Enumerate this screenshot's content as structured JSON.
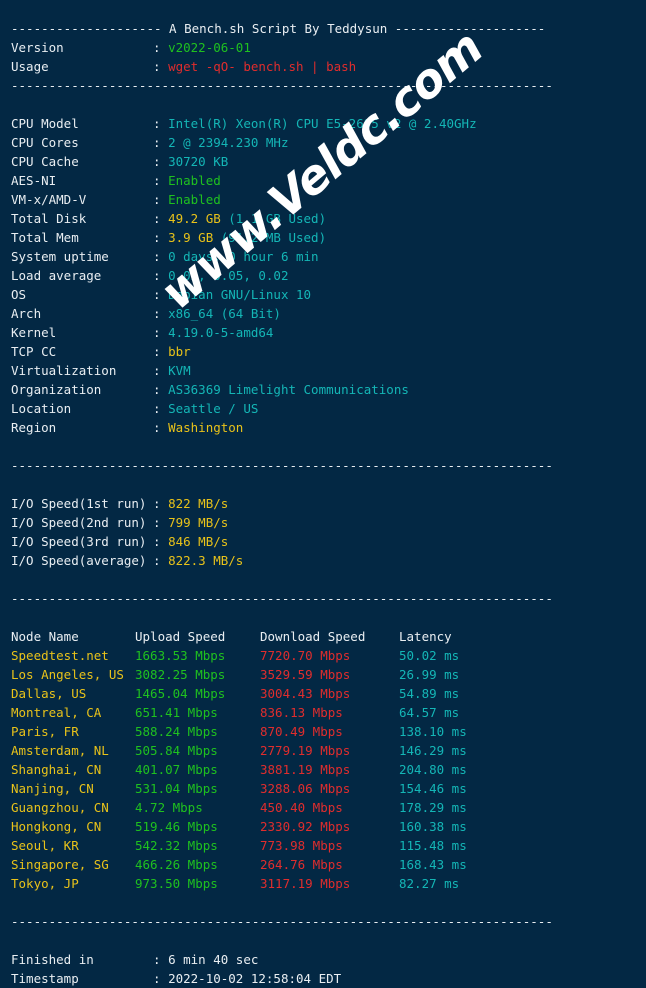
{
  "terminal": {
    "background": "#032844",
    "separator": "------------------------------------------------------------------------",
    "header_line": "-------------------- A Bench.sh Script By Teddysun --------------------"
  },
  "watermark": {
    "text": "www.Veldc.com"
  },
  "intro": {
    "rows": [
      {
        "label": "Version",
        "value": "v2022-06-01",
        "color": "green"
      },
      {
        "label": "Usage",
        "value": "wget -qO- bench.sh | bash",
        "color": "red"
      }
    ]
  },
  "sysinfo": {
    "rows": [
      {
        "label": "CPU Model",
        "value": "Intel(R) Xeon(R) CPU E5-2695 v2 @ 2.40GHz",
        "color": "cyan"
      },
      {
        "label": "CPU Cores",
        "value": "2 @ 2394.230 MHz",
        "color": "cyan"
      },
      {
        "label": "CPU Cache",
        "value": "30720 KB",
        "color": "cyan"
      },
      {
        "label": "AES-NI",
        "value": "Enabled",
        "color": "green"
      },
      {
        "label": "VM-x/AMD-V",
        "value": "Enabled",
        "color": "green"
      },
      {
        "label": "Total Disk",
        "value": "49.2 GB",
        "suffix": " (1.1 GB Used)",
        "color": "yellow",
        "suffix_color": "cyan"
      },
      {
        "label": "Total Mem",
        "value": "3.9 GB",
        "suffix": " (91.2 MB Used)",
        "color": "yellow",
        "suffix_color": "cyan"
      },
      {
        "label": "System uptime",
        "value": "0 days, 0 hour 6 min",
        "color": "cyan"
      },
      {
        "label": "Load average",
        "value": "0.02, 0.05, 0.02",
        "color": "cyan"
      },
      {
        "label": "OS",
        "value": "Debian GNU/Linux 10",
        "color": "cyan"
      },
      {
        "label": "Arch",
        "value": "x86_64 (64 Bit)",
        "color": "cyan"
      },
      {
        "label": "Kernel",
        "value": "4.19.0-5-amd64",
        "color": "cyan"
      },
      {
        "label": "TCP CC",
        "value": "bbr",
        "color": "yellow"
      },
      {
        "label": "Virtualization",
        "value": "KVM",
        "color": "cyan"
      },
      {
        "label": "Organization",
        "value": "AS36369 Limelight Communications",
        "color": "cyan"
      },
      {
        "label": "Location",
        "value": "Seattle / US",
        "color": "cyan"
      },
      {
        "label": "Region",
        "value": "Washington",
        "color": "yellow"
      }
    ]
  },
  "io": {
    "rows": [
      {
        "label": "I/O Speed(1st run)",
        "value": "822 MB/s",
        "color": "yellow"
      },
      {
        "label": "I/O Speed(2nd run)",
        "value": "799 MB/s",
        "color": "yellow"
      },
      {
        "label": "I/O Speed(3rd run)",
        "value": "846 MB/s",
        "color": "yellow"
      },
      {
        "label": "I/O Speed(average)",
        "value": "822.3 MB/s",
        "color": "yellow"
      }
    ]
  },
  "speedtest": {
    "columns": [
      "Node Name",
      "Upload Speed",
      "Download Speed",
      "Latency"
    ],
    "rows": [
      {
        "node": "Speedtest.net",
        "upload": "1663.53 Mbps",
        "download": "7720.70 Mbps",
        "latency": "50.02 ms"
      },
      {
        "node": "Los Angeles, US",
        "upload": "3082.25 Mbps",
        "download": "3529.59 Mbps",
        "latency": "26.99 ms"
      },
      {
        "node": "Dallas, US",
        "upload": "1465.04 Mbps",
        "download": "3004.43 Mbps",
        "latency": "54.89 ms"
      },
      {
        "node": "Montreal, CA",
        "upload": "651.41 Mbps",
        "download": "836.13 Mbps",
        "latency": "64.57 ms"
      },
      {
        "node": "Paris, FR",
        "upload": "588.24 Mbps",
        "download": "870.49 Mbps",
        "latency": "138.10 ms"
      },
      {
        "node": "Amsterdam, NL",
        "upload": "505.84 Mbps",
        "download": "2779.19 Mbps",
        "latency": "146.29 ms"
      },
      {
        "node": "Shanghai, CN",
        "upload": "401.07 Mbps",
        "download": "3881.19 Mbps",
        "latency": "204.80 ms"
      },
      {
        "node": "Nanjing, CN",
        "upload": "531.04 Mbps",
        "download": "3288.06 Mbps",
        "latency": "154.46 ms"
      },
      {
        "node": "Guangzhou, CN",
        "upload": "4.72 Mbps",
        "download": "450.40 Mbps",
        "latency": "178.29 ms"
      },
      {
        "node": "Hongkong, CN",
        "upload": "519.46 Mbps",
        "download": "2330.92 Mbps",
        "latency": "160.38 ms"
      },
      {
        "node": "Seoul, KR",
        "upload": "542.32 Mbps",
        "download": "773.98 Mbps",
        "latency": "115.48 ms"
      },
      {
        "node": "Singapore, SG",
        "upload": "466.26 Mbps",
        "download": "264.76 Mbps",
        "latency": "168.43 ms"
      },
      {
        "node": "Tokyo, JP",
        "upload": "973.50 Mbps",
        "download": "3117.19 Mbps",
        "latency": "82.27 ms"
      }
    ]
  },
  "footer": {
    "rows": [
      {
        "label": "Finished in",
        "value": "6 min 40 sec",
        "color": "white"
      },
      {
        "label": "Timestamp",
        "value": "2022-10-02 12:58:04 EDT",
        "color": "white"
      }
    ]
  }
}
